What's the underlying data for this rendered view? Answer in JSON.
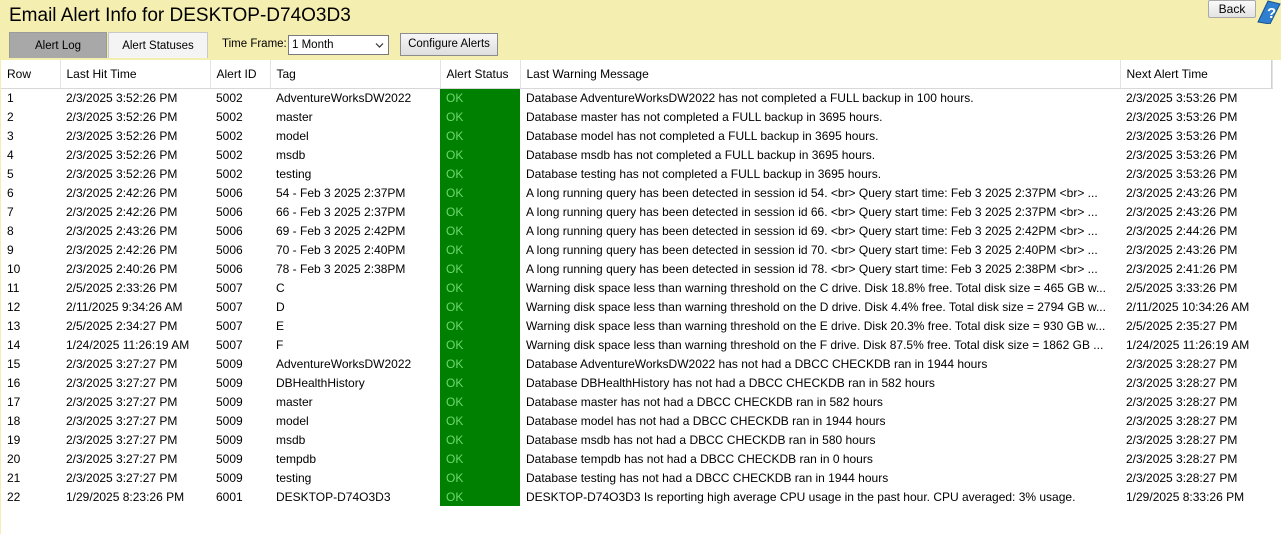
{
  "window": {
    "title": "Email Alert Info for DESKTOP-D74O3D3",
    "back_label": "Back"
  },
  "toolbar": {
    "tabs": [
      {
        "label": "Alert Log",
        "selected": false
      },
      {
        "label": "Alert Statuses",
        "selected": true
      }
    ],
    "time_frame_label": "Time Frame:",
    "time_frame_value": "1 Month",
    "configure_label": "Configure Alerts"
  },
  "colors": {
    "background": "#f5eeb1",
    "status_ok_bg": "#008000",
    "status_ok_text": "#6ed86e"
  },
  "table": {
    "headers": [
      "Row",
      "Last Hit Time",
      "Alert ID",
      "Tag",
      "Alert Status",
      "Last Warning Message",
      "Next Alert Time"
    ],
    "rows": [
      [
        "1",
        "2/3/2025 3:52:26 PM",
        "5002",
        "AdventureWorksDW2022",
        "OK",
        "Database AdventureWorksDW2022 has not completed a FULL backup in 100 hours.",
        "2/3/2025 3:53:26 PM"
      ],
      [
        "2",
        "2/3/2025 3:52:26 PM",
        "5002",
        "master",
        "OK",
        "Database master has not completed a FULL backup in 3695 hours.",
        "2/3/2025 3:53:26 PM"
      ],
      [
        "3",
        "2/3/2025 3:52:26 PM",
        "5002",
        "model",
        "OK",
        "Database model has not completed a FULL backup in 3695 hours.",
        "2/3/2025 3:53:26 PM"
      ],
      [
        "4",
        "2/3/2025 3:52:26 PM",
        "5002",
        "msdb",
        "OK",
        "Database msdb has not completed a FULL backup in 3695 hours.",
        "2/3/2025 3:53:26 PM"
      ],
      [
        "5",
        "2/3/2025 3:52:26 PM",
        "5002",
        "testing",
        "OK",
        "Database testing has not completed a FULL backup in 3695 hours.",
        "2/3/2025 3:53:26 PM"
      ],
      [
        "6",
        "2/3/2025 2:42:26 PM",
        "5006",
        "54 - Feb  3 2025  2:37PM",
        "OK",
        "A long running query has been detected in session id 54. <br> Query start time: Feb  3 2025  2:37PM <br> ...",
        "2/3/2025 2:43:26 PM"
      ],
      [
        "7",
        "2/3/2025 2:42:26 PM",
        "5006",
        "66 - Feb  3 2025  2:37PM",
        "OK",
        "A long running query has been detected in session id 66. <br> Query start time: Feb  3 2025  2:37PM <br> ...",
        "2/3/2025 2:43:26 PM"
      ],
      [
        "8",
        "2/3/2025 2:43:26 PM",
        "5006",
        "69 - Feb  3 2025  2:42PM",
        "OK",
        "A long running query has been detected in session id 69. <br> Query start time: Feb  3 2025  2:42PM <br> ...",
        "2/3/2025 2:44:26 PM"
      ],
      [
        "9",
        "2/3/2025 2:42:26 PM",
        "5006",
        "70 - Feb  3 2025  2:40PM",
        "OK",
        "A long running query has been detected in session id 70. <br> Query start time: Feb  3 2025  2:40PM <br> ...",
        "2/3/2025 2:43:26 PM"
      ],
      [
        "10",
        "2/3/2025 2:40:26 PM",
        "5006",
        "78 - Feb  3 2025  2:38PM",
        "OK",
        "A long running query has been detected in session id 78. <br> Query start time: Feb  3 2025  2:38PM <br> ...",
        "2/3/2025 2:41:26 PM"
      ],
      [
        "11",
        "2/5/2025 2:33:26 PM",
        "5007",
        "C",
        "OK",
        "Warning disk space less than warning threshold on the C drive. Disk 18.8% free. Total disk size = 465 GB w...",
        "2/5/2025 3:33:26 PM"
      ],
      [
        "12",
        "2/11/2025 9:34:26 AM",
        "5007",
        "D",
        "OK",
        "Warning disk space less than warning threshold on the D drive. Disk 4.4% free. Total disk size = 2794 GB w...",
        "2/11/2025 10:34:26 AM"
      ],
      [
        "13",
        "2/5/2025 2:34:27 PM",
        "5007",
        "E",
        "OK",
        "Warning disk space less than warning threshold on the E drive. Disk 20.3% free. Total disk size = 930 GB w...",
        "2/5/2025 2:35:27 PM"
      ],
      [
        "14",
        "1/24/2025 11:26:19 AM",
        "5007",
        "F",
        "OK",
        "Warning disk space less than warning threshold on the F drive. Disk 87.5% free. Total disk size = 1862 GB ...",
        "1/24/2025 11:26:19 AM"
      ],
      [
        "15",
        "2/3/2025 3:27:27 PM",
        "5009",
        "AdventureWorksDW2022",
        "OK",
        "Database AdventureWorksDW2022 has not had a DBCC CHECKDB ran in 1944 hours",
        "2/3/2025 3:28:27 PM"
      ],
      [
        "16",
        "2/3/2025 3:27:27 PM",
        "5009",
        "DBHealthHistory",
        "OK",
        "Database DBHealthHistory has not had a DBCC CHECKDB ran in 582 hours",
        "2/3/2025 3:28:27 PM"
      ],
      [
        "17",
        "2/3/2025 3:27:27 PM",
        "5009",
        "master",
        "OK",
        "Database master has not had a DBCC CHECKDB ran in 582 hours",
        "2/3/2025 3:28:27 PM"
      ],
      [
        "18",
        "2/3/2025 3:27:27 PM",
        "5009",
        "model",
        "OK",
        "Database model has not had a DBCC CHECKDB ran in 1944 hours",
        "2/3/2025 3:28:27 PM"
      ],
      [
        "19",
        "2/3/2025 3:27:27 PM",
        "5009",
        "msdb",
        "OK",
        "Database msdb has not had a DBCC CHECKDB ran in 580 hours",
        "2/3/2025 3:28:27 PM"
      ],
      [
        "20",
        "2/3/2025 3:27:27 PM",
        "5009",
        "tempdb",
        "OK",
        "Database tempdb has not had a DBCC CHECKDB ran in 0 hours",
        "2/3/2025 3:28:27 PM"
      ],
      [
        "21",
        "2/3/2025 3:27:27 PM",
        "5009",
        "testing",
        "OK",
        "Database testing has not had a DBCC CHECKDB ran in 1944 hours",
        "2/3/2025 3:28:27 PM"
      ],
      [
        "22",
        "1/29/2025 8:23:26 PM",
        "6001",
        "DESKTOP-D74O3D3",
        "OK",
        "DESKTOP-D74O3D3 Is reporting high average CPU usage in the past hour. CPU averaged: 3% usage.",
        "1/29/2025 8:33:26 PM"
      ]
    ]
  }
}
